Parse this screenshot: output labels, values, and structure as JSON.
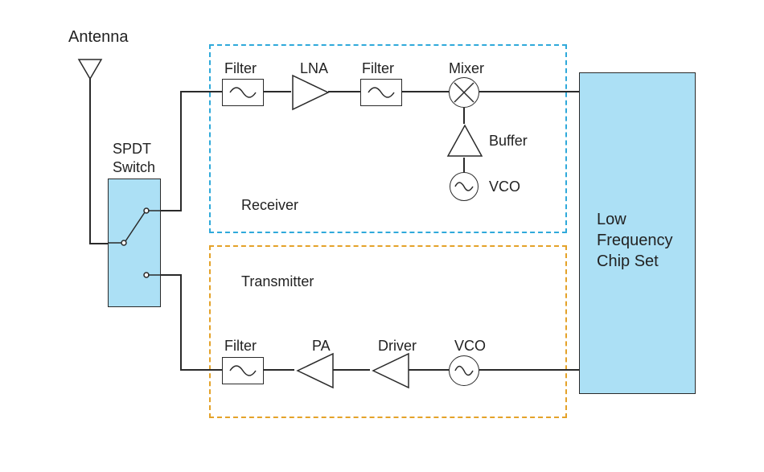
{
  "labels": {
    "antenna": "Antenna",
    "spdt": "SPDT",
    "switch": "Switch",
    "filter1": "Filter",
    "lna": "LNA",
    "filter2": "Filter",
    "mixer": "Mixer",
    "buffer": "Buffer",
    "vco_rx": "VCO",
    "receiver": "Receiver",
    "transmitter": "Transmitter",
    "filter3": "Filter",
    "pa": "PA",
    "driver": "Driver",
    "vco_tx": "VCO",
    "chipset_l1": "Low",
    "chipset_l2": "Frequency",
    "chipset_l3": "Chip Set"
  },
  "meta": {
    "diagram_type": "block diagram",
    "title": "RF Transceiver Block Diagram"
  }
}
